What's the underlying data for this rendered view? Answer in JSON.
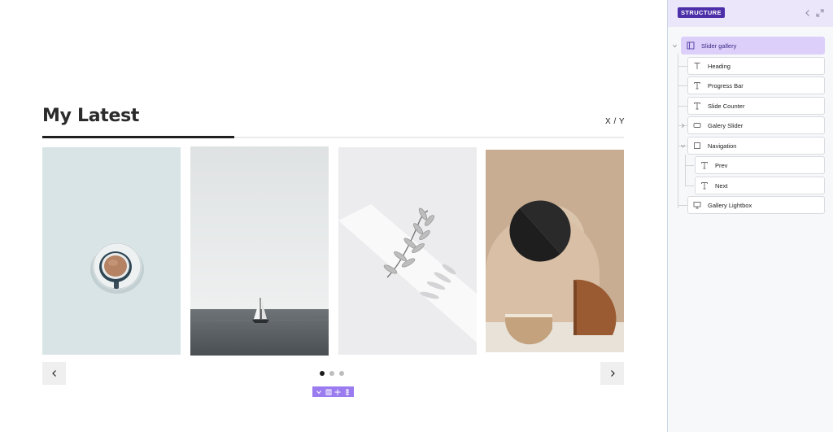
{
  "canvas": {
    "heading": "My Latest",
    "counter": "X / Y",
    "progress": 0.33,
    "slides": [
      {
        "subject": "coffee cup on saucer, top view"
      },
      {
        "subject": "sailboat on grey sea"
      },
      {
        "subject": "white leaf sprig with shadow"
      },
      {
        "subject": "abstract beige, black and terracotta shapes"
      }
    ],
    "pagination": {
      "count": 3,
      "active": 0
    },
    "nav": {
      "prev_icon": "chevron-left-icon",
      "next_icon": "chevron-right-icon"
    },
    "toolbar": {
      "icons": [
        "chevron-down-icon",
        "columns-icon",
        "move-icon",
        "resize-icon"
      ]
    }
  },
  "panel": {
    "title": "STRUCTURE",
    "tree": [
      {
        "label": "Slider gallery",
        "icon": "slider-icon",
        "selected": true,
        "expanded": true
      },
      {
        "label": "Heading",
        "icon": "text-icon"
      },
      {
        "label": "Progress Bar",
        "icon": "text-block-icon"
      },
      {
        "label": "Slide Counter",
        "icon": "text-block-icon"
      },
      {
        "label": "Galery Slider",
        "icon": "slider-box-icon",
        "collapsed": true
      },
      {
        "label": "Navigation",
        "icon": "square-icon",
        "expanded": true
      },
      {
        "label": "Prev",
        "icon": "text-block-icon"
      },
      {
        "label": "Next",
        "icon": "text-block-icon"
      },
      {
        "label": "Gallery Lightbox",
        "icon": "monitor-icon"
      }
    ]
  },
  "colors": {
    "accent": "#9b7cf0",
    "badge": "#4c2fa8",
    "selected_row": "#dccff9",
    "panel_header": "#ece6fb",
    "progress_fill": "#1f1f1f"
  }
}
